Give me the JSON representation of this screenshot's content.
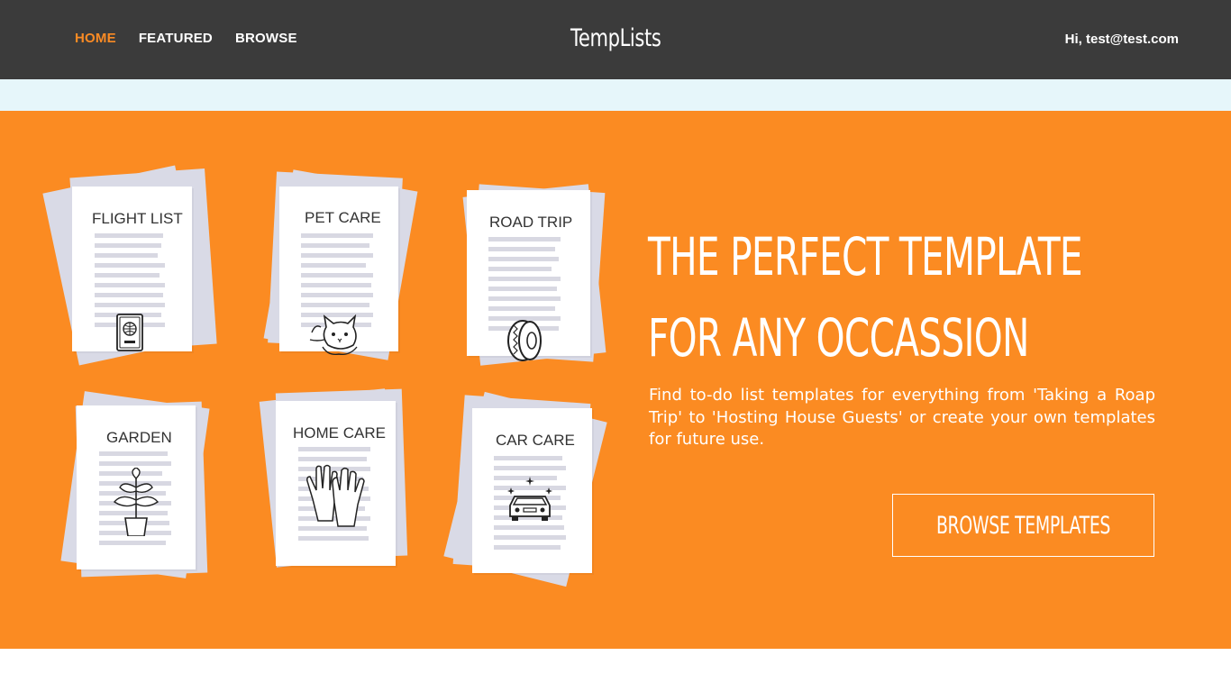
{
  "nav": {
    "home": "HOME",
    "featured": "FEATURED",
    "browse": "BROWSE",
    "active_color": "#fb8b24"
  },
  "brand": "TempLists",
  "user": {
    "greeting": "Hi, test@test.com"
  },
  "hero": {
    "background": "#fb8b22",
    "headline_line1": "THE PERFECT TEMPLATE",
    "headline_line2": "FOR ANY OCCASSION",
    "description": "Find to-do list templates for everything from 'Taking a Roap Trip' to 'Hosting House Guests' or create your own templates for future use.",
    "cta": "BROWSE TEMPLATES",
    "cards": [
      {
        "title": "FLIGHT LIST",
        "icon": "passport-icon"
      },
      {
        "title": "PET CARE",
        "icon": "cat-icon"
      },
      {
        "title": "ROAD TRIP",
        "icon": "tire-icon"
      },
      {
        "title": "GARDEN",
        "icon": "plant-icon"
      },
      {
        "title": "HOME CARE",
        "icon": "gloves-icon"
      },
      {
        "title": "CAR CARE",
        "icon": "car-icon"
      }
    ]
  }
}
